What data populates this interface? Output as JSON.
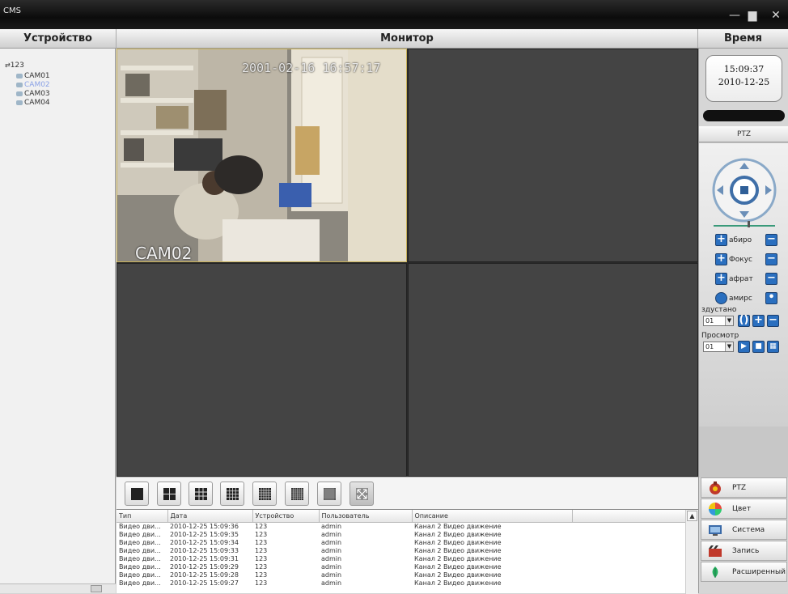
{
  "app": {
    "title": "CMS"
  },
  "window_buttons": {
    "minimize": "—",
    "restore": "▆",
    "close": "✕"
  },
  "headers": {
    "device": "Устройство",
    "monitor": "Монитор",
    "time": "Время"
  },
  "device_tree": {
    "root": "123",
    "cameras": [
      {
        "label": "CAM01",
        "selected": false
      },
      {
        "label": "CAM02",
        "selected": true
      },
      {
        "label": "CAM03",
        "selected": false
      },
      {
        "label": "CAM04",
        "selected": false
      }
    ]
  },
  "monitor": {
    "active_pane": {
      "timestamp": "2001-02-16 16:57:17",
      "camera_name": "CAM02"
    }
  },
  "split_buttons": [
    "1-screen-icon",
    "4-screen-icon",
    "9-screen-icon",
    "16-screen-icon",
    "25-screen-icon",
    "36-screen-icon",
    "64-screen-icon",
    "fullscreen-icon"
  ],
  "clock": {
    "time": "15:09:37",
    "date": "2010-12-25"
  },
  "ptz": {
    "title": "PTZ",
    "zoom_label": "абиро",
    "focus_label": "Фокус",
    "iris_label": "афрат",
    "wiper_label": "амирс",
    "preset_label": "здустано",
    "preset_value": "01",
    "tour_label": "Просмотр",
    "tour_value": "01"
  },
  "menu": [
    {
      "label": "PTZ",
      "icon": "ptz-icon"
    },
    {
      "label": "Цвет",
      "icon": "color-icon"
    },
    {
      "label": "Система",
      "icon": "system-icon"
    },
    {
      "label": "Запись",
      "icon": "record-icon"
    },
    {
      "label": "Расширенный",
      "icon": "advanced-icon"
    }
  ],
  "log": {
    "columns": [
      "Тип",
      "Дата",
      "Устройство",
      "Пользователь",
      "Описание"
    ],
    "rows": [
      [
        "Видео дви...",
        "2010-12-25 15:09:36",
        "123",
        "admin",
        "Канал 2 Видео движение"
      ],
      [
        "Видео дви...",
        "2010-12-25 15:09:35",
        "123",
        "admin",
        "Канал 2 Видео движение"
      ],
      [
        "Видео дви...",
        "2010-12-25 15:09:34",
        "123",
        "admin",
        "Канал 2 Видео движение"
      ],
      [
        "Видео дви...",
        "2010-12-25 15:09:33",
        "123",
        "admin",
        "Канал 2 Видео движение"
      ],
      [
        "Видео дви...",
        "2010-12-25 15:09:31",
        "123",
        "admin",
        "Канал 2 Видео движение"
      ],
      [
        "Видео дви...",
        "2010-12-25 15:09:29",
        "123",
        "admin",
        "Канал 2 Видео движение"
      ],
      [
        "Видео дви...",
        "2010-12-25 15:09:28",
        "123",
        "admin",
        "Канал 2 Видео движение"
      ],
      [
        "Видео дви...",
        "2010-12-25 15:09:27",
        "123",
        "admin",
        "Канал 2 Видео движение"
      ]
    ]
  }
}
